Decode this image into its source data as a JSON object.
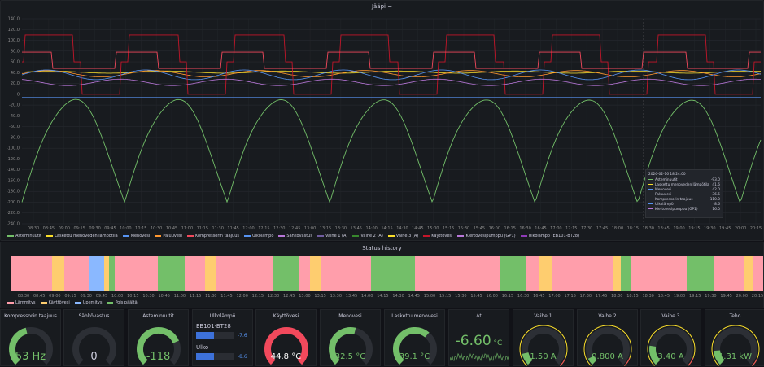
{
  "main_panel": {
    "title": "Jääpi ~"
  },
  "chart_data": {
    "type": "line",
    "y_ticks": [
      "140.0",
      "120.0",
      "100.0",
      "80.0",
      "60.0",
      "40.0",
      "20.0",
      "0",
      "-20.0",
      "-40.0",
      "-60.0",
      "-80.0",
      "-100.0",
      "-120.0",
      "-140.0",
      "-160.0",
      "-180.0",
      "-200.0",
      "-220.0",
      "-240.0"
    ],
    "ylim": [
      -240,
      140
    ],
    "x_ticks": [
      "08:30",
      "08:45",
      "09:00",
      "09:15",
      "09:30",
      "09:45",
      "10:00",
      "10:15",
      "10:30",
      "10:45",
      "11:00",
      "11:15",
      "11:30",
      "11:45",
      "12:00",
      "12:15",
      "12:30",
      "12:45",
      "13:00",
      "13:15",
      "13:30",
      "13:45",
      "14:00",
      "14:15",
      "14:30",
      "14:45",
      "15:00",
      "15:15",
      "15:30",
      "15:45",
      "16:00",
      "16:15",
      "16:30",
      "16:45",
      "17:00",
      "17:15",
      "17:30",
      "17:45",
      "18:00",
      "18:15",
      "18:30",
      "18:45",
      "19:00",
      "19:15",
      "19:30",
      "19:45",
      "20:00",
      "20:15"
    ],
    "series": [
      {
        "name": "Asteminuutit",
        "color": "#73bf69"
      },
      {
        "name": "Laskettu menoveden lämpötila",
        "color": "#fade2a"
      },
      {
        "name": "Menovesi",
        "color": "#5794f2"
      },
      {
        "name": "Paluuvesi",
        "color": "#ff9830"
      },
      {
        "name": "Kompressorin taajuus",
        "color": "#f2495c"
      },
      {
        "name": "Ulkolämpö",
        "color": "#5794f2"
      },
      {
        "name": "Sähkövastus",
        "color": "#b877d9"
      },
      {
        "name": "Vaihe 1 (A)",
        "color": "#705da0"
      },
      {
        "name": "Vaihe 2 (A)",
        "color": "#37872d"
      },
      {
        "name": "Vaihe 3 (A)",
        "color": "#fade2a"
      },
      {
        "name": "Käyttövesi",
        "color": "#c4162a"
      },
      {
        "name": "Kiertovesipumppu (GP1)",
        "color": "#b877d9"
      },
      {
        "name": "Ulkolämpö (EB101-BT28)",
        "color": "#8f3bb8"
      }
    ]
  },
  "tooltip": {
    "time": "2026-02-16 18:24:00",
    "rows": [
      {
        "name": "Asteminuutit",
        "value": "-93.0",
        "color": "#73bf69"
      },
      {
        "name": "Laskettu menoveden lämpötila",
        "value": "41.6",
        "color": "#fade2a"
      },
      {
        "name": "Menovesi",
        "value": "42.0",
        "color": "#5794f2"
      },
      {
        "name": "Paluuvesi",
        "value": "36.5",
        "color": "#ff9830"
      },
      {
        "name": "Kompressorin taajuus",
        "value": "110.0",
        "color": "#f2495c"
      },
      {
        "name": "Ulkolämpö",
        "value": "-8.6",
        "color": "#5794f2"
      },
      {
        "name": "Kiertovesipumppu (GP1)",
        "value": "16.0",
        "color": "#b877d9"
      }
    ]
  },
  "status_panel": {
    "title": "Status history",
    "x_ticks": [
      "08:30",
      "08:45",
      "09:00",
      "09:15",
      "09:30",
      "09:45",
      "10:00",
      "10:15",
      "10:30",
      "10:45",
      "11:00",
      "11:15",
      "11:30",
      "11:45",
      "12:00",
      "12:15",
      "12:30",
      "12:45",
      "13:00",
      "13:15",
      "13:30",
      "13:45",
      "14:00",
      "14:15",
      "14:30",
      "14:45",
      "15:00",
      "15:15",
      "15:30",
      "15:45",
      "16:00",
      "16:15",
      "16:30",
      "16:45",
      "17:00",
      "17:15",
      "17:30",
      "17:45",
      "18:00",
      "18:15",
      "18:30",
      "18:45",
      "19:00",
      "19:15",
      "19:30",
      "19:45",
      "20:00",
      "20:15"
    ],
    "legend": [
      {
        "label": "Lämmitys",
        "color": "#ff9eab"
      },
      {
        "label": "Käyttövesi",
        "color": "#fecd6f"
      },
      {
        "label": "Upemitys",
        "color": "#8ab8ff"
      },
      {
        "label": "Pois päältä",
        "color": "#73bf69"
      }
    ]
  },
  "gauges": [
    {
      "title": "Kompressorin taajuus",
      "value": "53 Hz",
      "color": "#73bf69",
      "fraction": 0.45
    },
    {
      "title": "Sähkövastus",
      "value": "0",
      "color": "#73bf69",
      "fraction": 0
    },
    {
      "title": "Asteminuutit",
      "value": "-118",
      "color": "#73bf69",
      "fraction": 0.75
    },
    {
      "title": "Ulkolämpö",
      "value": "",
      "color": "#5794f2",
      "fraction": 0
    },
    {
      "title": "Käyttövesi",
      "value": "44.8 °C",
      "color": "#f2495c",
      "fraction": 1.0
    },
    {
      "title": "Menovesi",
      "value": "32.5 °C",
      "color": "#73bf69",
      "fraction": 0.55
    },
    {
      "title": "Laskettu menovesi",
      "value": "39.1 °C",
      "color": "#73bf69",
      "fraction": 0.65
    },
    {
      "title": "Δt",
      "value": "-6.60",
      "color": "#73bf69",
      "fraction": 0
    },
    {
      "title": "Vaihe 1",
      "value": "1.50 A",
      "color": "#73bf69",
      "fraction": 0.12
    },
    {
      "title": "Vaihe 2",
      "value": "0.800 A",
      "color": "#73bf69",
      "fraction": 0.07
    },
    {
      "title": "Vaihe 3",
      "value": "3.40 A",
      "color": "#73bf69",
      "fraction": 0.2
    },
    {
      "title": "Teho",
      "value": "1.31 kW",
      "color": "#73bf69",
      "fraction": 0.15
    }
  ],
  "ulko": {
    "bars": [
      {
        "label": "EB101-BT28",
        "value": "-7.6"
      },
      {
        "label": "Ulko",
        "value": "-8.6"
      }
    ]
  },
  "delta": {
    "unit": "°C"
  }
}
